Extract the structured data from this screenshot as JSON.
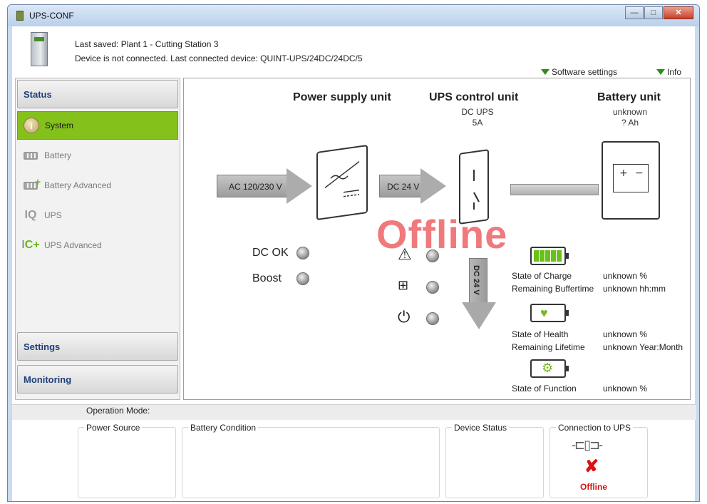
{
  "window": {
    "title": "UPS-CONF",
    "buttons": {
      "minimize": "—",
      "maximize": "□",
      "close": "✕"
    }
  },
  "header": {
    "last_saved": "Last saved: Plant 1 - Cutting Station 3",
    "connection": "Device is not connected. Last connected device: QUINT-UPS/24DC/24DC/5",
    "software_settings": "Software settings",
    "info": "Info"
  },
  "sidebar": {
    "sections": {
      "status": "Status",
      "settings": "Settings",
      "monitoring": "Monitoring"
    },
    "items": [
      {
        "label": "System",
        "icon": "info-icon",
        "active": true
      },
      {
        "label": "Battery",
        "icon": "battery-icon",
        "active": false
      },
      {
        "label": "Battery Advanced",
        "icon": "battery-advanced-icon",
        "active": false
      },
      {
        "label": "UPS",
        "icon": "ups-icon",
        "active": false
      },
      {
        "label": "UPS Advanced",
        "icon": "ups-advanced-icon",
        "active": false
      }
    ]
  },
  "diagram": {
    "psu_title": "Power supply unit",
    "ups_title": "UPS control unit",
    "ups_sub1": "DC UPS",
    "ups_sub2": "5A",
    "battery_title": "Battery unit",
    "battery_sub1": "unknown",
    "battery_sub2": "? Ah",
    "ac_arrow": "AC 120/230 V",
    "dc_arrow": "DC 24 V",
    "dc_down_arrow": "DC 24 V",
    "offline_watermark": "Offline",
    "dc_ok": "DC OK",
    "boost": "Boost",
    "warning_symbol": "⚠",
    "power_symbol": "⏻"
  },
  "metrics": {
    "state_of_charge_label": "State of Charge",
    "state_of_charge_value": "unknown %",
    "remaining_buffertime_label": "Remaining Buffertime",
    "remaining_buffertime_value": "unknown hh:mm",
    "state_of_health_label": "State of Health",
    "state_of_health_value": "unknown %",
    "remaining_lifetime_label": "Remaining Lifetime",
    "remaining_lifetime_value": "unknown Year:Month",
    "state_of_function_label": "State of Function",
    "state_of_function_value": "unknown %"
  },
  "bottom": {
    "operation_mode": "Operation Mode:",
    "power_source": "Power Source",
    "battery_condition": "Battery Condition",
    "device_status": "Device Status",
    "connection_to_ups": "Connection to UPS",
    "connection_state": "Offline"
  },
  "colors": {
    "accent_green": "#84c11b",
    "offline_red": "#ee6e72",
    "error_red": "#dd1111"
  }
}
